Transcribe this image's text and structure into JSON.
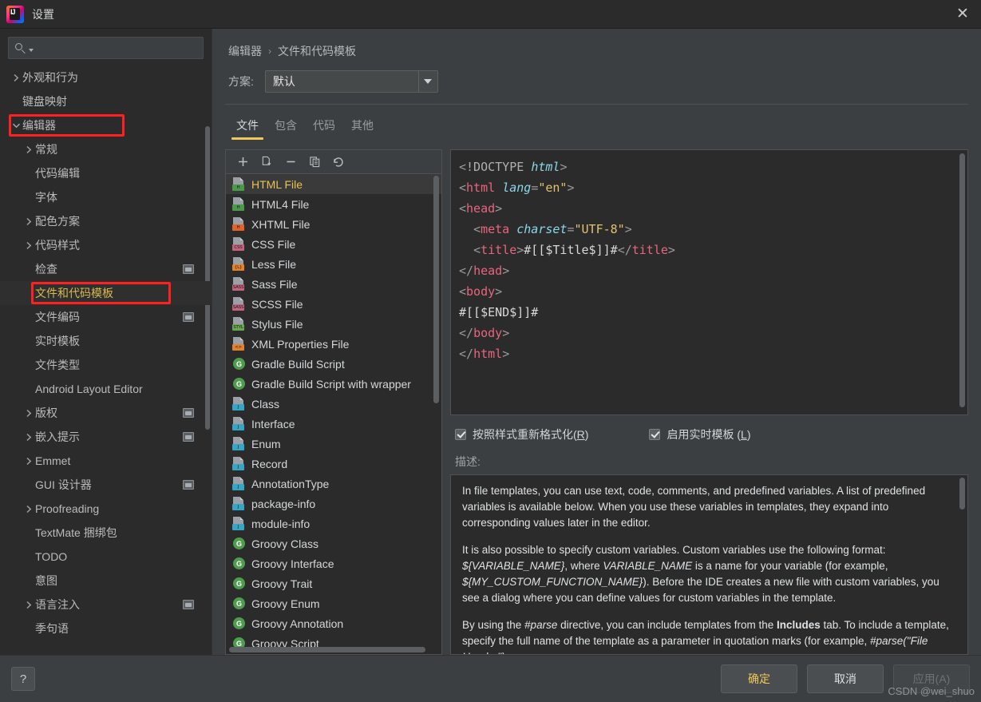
{
  "window": {
    "title": "设置",
    "logo_icon": "intellij-idea-logo",
    "close_icon": "close-icon"
  },
  "sidebar": {
    "search": {
      "placeholder": "",
      "value": "",
      "icon": "search-icon"
    },
    "items": [
      {
        "label": "外观和行为",
        "indent": 0,
        "twisty": "right",
        "config_icon": false
      },
      {
        "label": "键盘映射",
        "indent": 0,
        "twisty": "none",
        "config_icon": false
      },
      {
        "label": "编辑器",
        "indent": 0,
        "twisty": "down",
        "config_icon": false,
        "redbox": true
      },
      {
        "label": "常规",
        "indent": 1,
        "twisty": "right",
        "config_icon": false
      },
      {
        "label": "代码编辑",
        "indent": 1,
        "twisty": "none",
        "config_icon": false
      },
      {
        "label": "字体",
        "indent": 1,
        "twisty": "none",
        "config_icon": false
      },
      {
        "label": "配色方案",
        "indent": 1,
        "twisty": "right",
        "config_icon": false
      },
      {
        "label": "代码样式",
        "indent": 1,
        "twisty": "right",
        "config_icon": false
      },
      {
        "label": "检查",
        "indent": 1,
        "twisty": "none",
        "config_icon": true
      },
      {
        "label": "文件和代码模板",
        "indent": 1,
        "twisty": "none",
        "config_icon": false,
        "selected": true,
        "redbox": true
      },
      {
        "label": "文件编码",
        "indent": 1,
        "twisty": "none",
        "config_icon": true
      },
      {
        "label": "实时模板",
        "indent": 1,
        "twisty": "none",
        "config_icon": false
      },
      {
        "label": "文件类型",
        "indent": 1,
        "twisty": "none",
        "config_icon": false
      },
      {
        "label": "Android Layout Editor",
        "indent": 1,
        "twisty": "none",
        "config_icon": false
      },
      {
        "label": "版权",
        "indent": 1,
        "twisty": "right",
        "config_icon": true
      },
      {
        "label": "嵌入提示",
        "indent": 1,
        "twisty": "right",
        "config_icon": true
      },
      {
        "label": "Emmet",
        "indent": 1,
        "twisty": "right",
        "config_icon": false
      },
      {
        "label": "GUI 设计器",
        "indent": 1,
        "twisty": "none",
        "config_icon": true
      },
      {
        "label": "Proofreading",
        "indent": 1,
        "twisty": "right",
        "config_icon": false
      },
      {
        "label": "TextMate 捆绑包",
        "indent": 1,
        "twisty": "none",
        "config_icon": false
      },
      {
        "label": "TODO",
        "indent": 1,
        "twisty": "none",
        "config_icon": false
      },
      {
        "label": "意图",
        "indent": 1,
        "twisty": "none",
        "config_icon": false
      },
      {
        "label": "语言注入",
        "indent": 1,
        "twisty": "right",
        "config_icon": true
      },
      {
        "label": "季句语",
        "indent": 1,
        "twisty": "none",
        "config_icon": false
      }
    ]
  },
  "main": {
    "breadcrumb": {
      "parent": "编辑器",
      "separator": "›",
      "current": "文件和代码模板"
    },
    "scheme": {
      "label": "方案:",
      "value": "默认",
      "dropdown_icon": "chevron-down-icon"
    },
    "tabs": [
      {
        "label": "文件",
        "active": true
      },
      {
        "label": "包含",
        "active": false
      },
      {
        "label": "代码",
        "active": false
      },
      {
        "label": "其他",
        "active": false
      }
    ],
    "list_toolbar": [
      {
        "icon": "add-icon",
        "name": "add-template-button"
      },
      {
        "icon": "copy-template-icon",
        "name": "copy-template-button"
      },
      {
        "icon": "remove-icon",
        "name": "remove-template-button"
      },
      {
        "icon": "duplicate-icon",
        "name": "duplicate-template-button"
      },
      {
        "icon": "reset-icon",
        "name": "reset-template-button"
      }
    ],
    "templates": [
      {
        "label": "HTML File",
        "icon": "html-file-icon",
        "badge": "H",
        "badge_color": "#4a9a4a",
        "selected": true
      },
      {
        "label": "HTML4 File",
        "icon": "html4-file-icon",
        "badge": "H",
        "badge_color": "#4a9a4a"
      },
      {
        "label": "XHTML File",
        "icon": "xhtml-file-icon",
        "badge": "H",
        "badge_color": "#e2622a"
      },
      {
        "label": "CSS File",
        "icon": "css-file-icon",
        "badge": "CSS",
        "badge_color": "#c2657f"
      },
      {
        "label": "Less File",
        "icon": "less-file-icon",
        "badge": "{L}",
        "badge_color": "#e2822a"
      },
      {
        "label": "Sass File",
        "icon": "sass-file-icon",
        "badge": "SASS",
        "badge_color": "#c2657f"
      },
      {
        "label": "SCSS File",
        "icon": "scss-file-icon",
        "badge": "SASS",
        "badge_color": "#c2657f"
      },
      {
        "label": "Stylus File",
        "icon": "stylus-file-icon",
        "badge": "STYL",
        "badge_color": "#6aa84f"
      },
      {
        "label": "XML Properties File",
        "icon": "xml-properties-file-icon",
        "badge": "<>",
        "badge_color": "#e2822a"
      },
      {
        "label": "Gradle Build Script",
        "icon": "gradle-icon",
        "circle": "G",
        "circle_color": "#4f9c4f"
      },
      {
        "label": "Gradle Build Script with wrapper",
        "icon": "gradle-icon",
        "circle": "G",
        "circle_color": "#4f9c4f"
      },
      {
        "label": "Class",
        "icon": "java-class-icon",
        "badge": "J",
        "badge_color": "#37a5c4"
      },
      {
        "label": "Interface",
        "icon": "java-interface-icon",
        "badge": "J",
        "badge_color": "#37a5c4"
      },
      {
        "label": "Enum",
        "icon": "java-enum-icon",
        "badge": "J",
        "badge_color": "#37a5c4"
      },
      {
        "label": "Record",
        "icon": "java-record-icon",
        "badge": "J",
        "badge_color": "#37a5c4"
      },
      {
        "label": "AnnotationType",
        "icon": "java-annotation-icon",
        "badge": "J",
        "badge_color": "#37a5c4"
      },
      {
        "label": "package-info",
        "icon": "java-package-info-icon",
        "badge": "J",
        "badge_color": "#37a5c4"
      },
      {
        "label": "module-info",
        "icon": "java-module-info-icon",
        "badge": "J",
        "badge_color": "#37a5c4"
      },
      {
        "label": "Groovy Class",
        "icon": "groovy-icon",
        "circle": "G",
        "circle_color": "#4f9c4f"
      },
      {
        "label": "Groovy Interface",
        "icon": "groovy-icon",
        "circle": "G",
        "circle_color": "#4f9c4f"
      },
      {
        "label": "Groovy Trait",
        "icon": "groovy-icon",
        "circle": "G",
        "circle_color": "#4f9c4f"
      },
      {
        "label": "Groovy Enum",
        "icon": "groovy-icon",
        "circle": "G",
        "circle_color": "#4f9c4f"
      },
      {
        "label": "Groovy Annotation",
        "icon": "groovy-icon",
        "circle": "G",
        "circle_color": "#4f9c4f"
      },
      {
        "label": "Groovy Script",
        "icon": "groovy-icon",
        "circle": "G",
        "circle_color": "#4f9c4f"
      }
    ],
    "editor": {
      "lines": [
        "<!DOCTYPE html>",
        "<html lang=\"en\">",
        "<head>",
        "  <meta charset=\"UTF-8\">",
        "  <title>#[[$Title$]]#</title>",
        "</head>",
        "<body>",
        "#[[$END$]]#",
        "</body>",
        "</html>"
      ]
    },
    "checkboxes": [
      {
        "label_pre": "按照样式重新格式化(",
        "label_key": "R",
        "label_post": ")",
        "checked": true
      },
      {
        "label_pre": "启用实时模板 (",
        "label_key": "L",
        "label_post": ")",
        "checked": true
      }
    ],
    "description": {
      "label": "描述:",
      "paragraphs": [
        "In file templates, you can use text, code, comments, and predefined variables. A list of predefined variables is available below. When you use these variables in templates, they expand into corresponding values later in the editor.",
        "It is also possible to specify custom variables. Custom variables use the following format: ${VARIABLE_NAME}, where VARIABLE_NAME is a name for your variable (for example, ${MY_CUSTOM_FUNCTION_NAME}). Before the IDE creates a new file with custom variables, you see a dialog where you can define values for custom variables in the template.",
        "By using the #parse directive, you can include templates from the Includes tab. To include a template, specify the full name of the template as a parameter in quotation marks (for example, #parse(\"File Header\")."
      ]
    }
  },
  "footer": {
    "help_label": "?",
    "ok_label": "确定",
    "cancel_label": "取消",
    "apply_label": "应用(A)",
    "watermark": "CSDN @wei_shuo"
  },
  "colors": {
    "accent_yellow": "#f0c758",
    "redbox": "#ff2020",
    "bg_dialog": "#3c3f41",
    "bg_dark": "#2b2b2b"
  }
}
